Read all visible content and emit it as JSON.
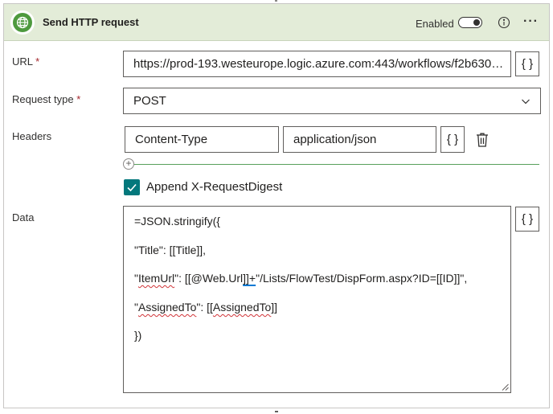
{
  "action": {
    "title": "Send HTTP request",
    "enabled_label": "Enabled",
    "enabled": true
  },
  "fields": {
    "url": {
      "label": "URL",
      "required_mark": "*",
      "value": "https://prod-193.westeurope.logic.azure.com:443/workflows/f2b630c...",
      "brace_label": "{ }"
    },
    "request_type": {
      "label": "Request type",
      "required_mark": "*",
      "value": "POST"
    },
    "headers": {
      "label": "Headers",
      "key": "Content-Type",
      "value": "application/json",
      "brace_label": "{ }"
    },
    "append_digest": {
      "label": "Append X-RequestDigest",
      "checked": true
    },
    "data": {
      "label": "Data",
      "brace_label": "{ }",
      "line1": "=JSON.stringify({",
      "line2": "\"Title\": [[Title]],",
      "line3_a": "\"",
      "line3_b": "ItemUrl",
      "line3_c": "\": [[@Web.Url",
      "line3_d": "]]+",
      "line3_e": "\"/Lists/FlowTest/DispForm.aspx?ID=[[ID]]\",",
      "line4_a": "\"",
      "line4_b": "AssignedTo",
      "line4_c": "\": [[",
      "line4_d": "AssignedTo",
      "line4_e": "]]",
      "line5": "})"
    }
  },
  "icons": {
    "header_icon": "globe-icon",
    "info": "info-icon",
    "more": "more-options-icon",
    "chevron": "chevron-down-icon",
    "delete": "trash-icon",
    "add": "plus-icon",
    "check": "checkmark-icon"
  },
  "colors": {
    "header_bg": "#e3ecd8",
    "globe": "#4e9a3e",
    "checkbox": "#03787c",
    "required": "#a4262c"
  }
}
